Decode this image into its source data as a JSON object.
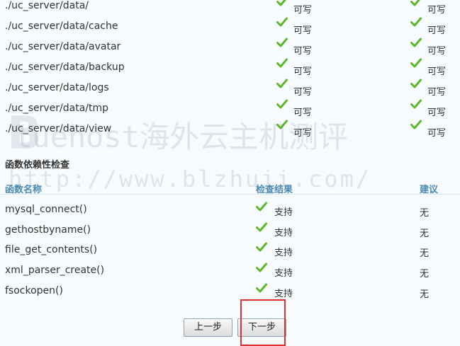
{
  "directories": [
    {
      "path": "./uc_server/data/",
      "required": "可写",
      "current": "可写"
    },
    {
      "path": "./uc_server/data/cache",
      "required": "可写",
      "current": "可写"
    },
    {
      "path": "./uc_server/data/avatar",
      "required": "可写",
      "current": "可写"
    },
    {
      "path": "./uc_server/data/backup",
      "required": "可写",
      "current": "可写"
    },
    {
      "path": "./uc_server/data/logs",
      "required": "可写",
      "current": "可写"
    },
    {
      "path": "./uc_server/data/tmp",
      "required": "可写",
      "current": "可写"
    },
    {
      "path": "./uc_server/data/view",
      "required": "可写",
      "current": "可写"
    }
  ],
  "functions_section": {
    "title": "函数依赖性检查",
    "headers": {
      "name": "函数名称",
      "result": "检查结果",
      "advice": "建议"
    },
    "rows": [
      {
        "name": "mysql_connect()",
        "result": "支持",
        "advice": "无"
      },
      {
        "name": "gethostbyname()",
        "result": "支持",
        "advice": "无"
      },
      {
        "name": "file_get_contents()",
        "result": "支持",
        "advice": "无"
      },
      {
        "name": "xml_parser_create()",
        "result": "支持",
        "advice": "无"
      },
      {
        "name": "fsockopen()",
        "result": "支持",
        "advice": "无"
      }
    ]
  },
  "buttons": {
    "prev": "上一步",
    "next": "下一步"
  },
  "watermark": {
    "line1": "luehost海外云主机测评",
    "line2": "http://www.blzhuii.com/"
  },
  "colors": {
    "check": "#5cb82a",
    "header": "#4a8ab0",
    "highlight_box": "#e03030"
  },
  "icons": {
    "status": "check-icon"
  }
}
